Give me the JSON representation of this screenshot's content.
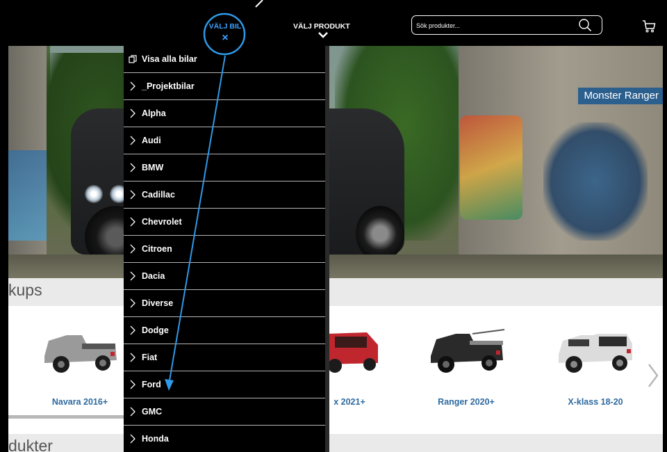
{
  "header": {
    "nav_bil_label": "VÄLJ BIL",
    "nav_bil_close": "×",
    "nav_produkt_label": "VÄLJ PRODUKT",
    "search_placeholder": "Sök produkter...",
    "icons": [
      "close-icon",
      "chevron-down-icon",
      "search-icon",
      "cart-icon"
    ]
  },
  "hero": {
    "badge": "Monster Ranger"
  },
  "sections": {
    "pickups_title": "kups",
    "produkter_title": "dukter"
  },
  "products": [
    {
      "label": "Navara 2016+",
      "color": "#9a9a9a"
    },
    {
      "label": "x 2021+",
      "color": "#c0262e"
    },
    {
      "label": "Ranger 2020+",
      "color": "#2a2a2a"
    },
    {
      "label": "X-klass 18-20",
      "color": "#dcdcdc"
    }
  ],
  "menu": {
    "items": [
      {
        "label": "Visa alla bilar",
        "icon": "copy-icon"
      },
      {
        "label": "_Projektbilar",
        "icon": "chevron-right-icon"
      },
      {
        "label": "Alpha",
        "icon": "chevron-right-icon"
      },
      {
        "label": "Audi",
        "icon": "chevron-right-icon"
      },
      {
        "label": "BMW",
        "icon": "chevron-right-icon"
      },
      {
        "label": "Cadillac",
        "icon": "chevron-right-icon"
      },
      {
        "label": "Chevrolet",
        "icon": "chevron-right-icon"
      },
      {
        "label": "Citroen",
        "icon": "chevron-right-icon"
      },
      {
        "label": "Dacia",
        "icon": "chevron-right-icon"
      },
      {
        "label": "Diverse",
        "icon": "chevron-right-icon"
      },
      {
        "label": "Dodge",
        "icon": "chevron-right-icon"
      },
      {
        "label": "Fiat",
        "icon": "chevron-right-icon"
      },
      {
        "label": "Ford",
        "icon": "chevron-right-icon"
      },
      {
        "label": "GMC",
        "icon": "chevron-right-icon"
      },
      {
        "label": "Honda",
        "icon": "chevron-right-icon"
      }
    ]
  },
  "colors": {
    "accent": "#3da0ff",
    "header_bg": "#000000",
    "link": "#2e6aa0",
    "badge_bg": "#2b5f8e"
  }
}
